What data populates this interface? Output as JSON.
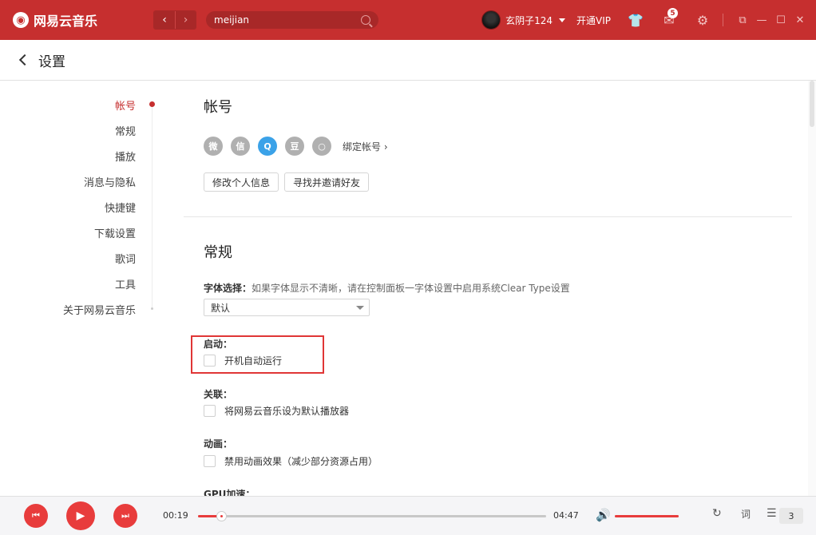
{
  "app": {
    "logo_mark": "◉",
    "name": "网易云音乐"
  },
  "titlebar": {
    "back_glyph": "‹",
    "forward_glyph": "›",
    "search_value": "meijian",
    "username": "玄阴子124",
    "vip_label": "开通VIP",
    "mail_badge": "5",
    "skin_glyph": "👕",
    "mail_glyph": "✉",
    "settings_glyph": "⚙",
    "mini_glyph": "⧉",
    "minimize_glyph": "—",
    "maximize_glyph": "☐",
    "close_glyph": "✕"
  },
  "header": {
    "title": "设置"
  },
  "nav": {
    "items": [
      {
        "label": "帐号"
      },
      {
        "label": "常规"
      },
      {
        "label": "播放"
      },
      {
        "label": "消息与隐私"
      },
      {
        "label": "快捷键"
      },
      {
        "label": "下载设置"
      },
      {
        "label": "歌词"
      },
      {
        "label": "工具"
      },
      {
        "label": "关于网易云音乐"
      }
    ]
  },
  "account": {
    "title": "帐号",
    "social_icons": [
      "weibo-icon",
      "wechat-icon",
      "qq-icon",
      "douban-icon",
      "other-icon"
    ],
    "social_glyphs": [
      "微",
      "信",
      "Q",
      "豆",
      "○"
    ],
    "bind_label": "绑定帐号 ›",
    "edit_profile": "修改个人信息",
    "invite_friends": "寻找并邀请好友"
  },
  "general": {
    "title": "常规",
    "font_label": "字体选择：",
    "font_hint": "如果字体显示不清晰，请在控制面板一字体设置中启用系统Clear Type设置",
    "font_value": "默认",
    "startup_label": "启动：",
    "startup_option": "开机自动运行",
    "association_label": "关联：",
    "association_option": "将网易云音乐设为默认播放器",
    "animation_label": "动画：",
    "animation_option": "禁用动画效果（减少部分资源占用）",
    "gpu_label": "GPU加速："
  },
  "player": {
    "prev_glyph": "⏮",
    "play_glyph": "▶",
    "next_glyph": "⏭",
    "current_time": "00:19",
    "total_time": "04:47",
    "progress": 0.066,
    "volume": 1.0,
    "volume_glyph": "🔊",
    "loop_glyph": "↻",
    "lyrics_glyph": "词",
    "playlist_glyph": "☰",
    "playlist_count": "3"
  },
  "colors": {
    "brand": "#c62f2f",
    "player_accent": "#e83c3c",
    "highlight_box": "#e03636"
  }
}
